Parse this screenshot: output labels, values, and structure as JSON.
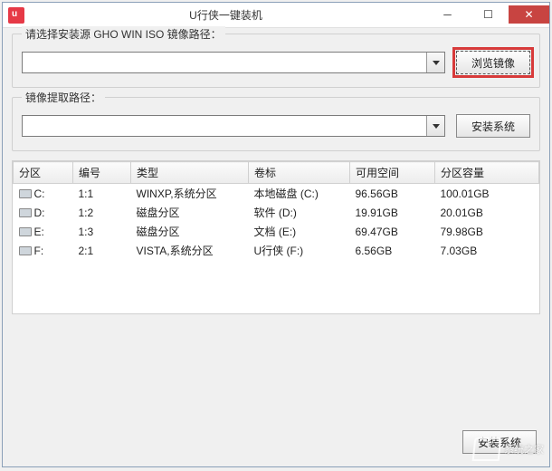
{
  "window": {
    "title": "U行侠一键装机"
  },
  "group1": {
    "label": "请选择安装源 GHO WIN ISO 镜像路径：",
    "browse_btn": "浏览镜像",
    "combo_value": ""
  },
  "group2": {
    "label": "镜像提取路径：",
    "install_btn": "安装系统",
    "combo_value": ""
  },
  "table": {
    "headers": [
      "分区",
      "编号",
      "类型",
      "卷标",
      "可用空间",
      "分区容量"
    ],
    "rows": [
      {
        "drive": "C:",
        "num": "1:1",
        "type": "WINXP,系统分区",
        "label": "本地磁盘 (C:)",
        "free": "96.56GB",
        "cap": "100.01GB"
      },
      {
        "drive": "D:",
        "num": "1:2",
        "type": "磁盘分区",
        "label": "软件 (D:)",
        "free": "19.91GB",
        "cap": "20.01GB"
      },
      {
        "drive": "E:",
        "num": "1:3",
        "type": "磁盘分区",
        "label": "文档 (E:)",
        "free": "69.47GB",
        "cap": "79.98GB"
      },
      {
        "drive": "F:",
        "num": "2:1",
        "type": "VISTA,系统分区",
        "label": "U行侠 (F:)",
        "free": "6.56GB",
        "cap": "7.03GB"
      }
    ]
  },
  "footer": {
    "install_btn": "安装系统"
  },
  "watermark": "系统之家"
}
